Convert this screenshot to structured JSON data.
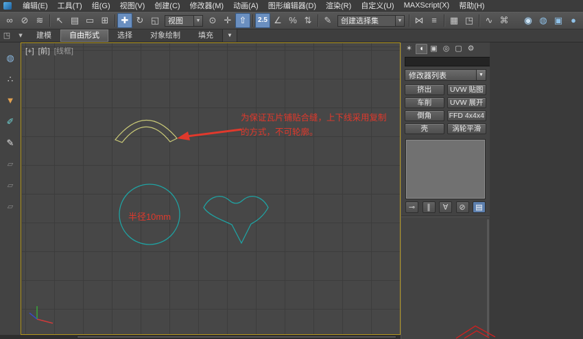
{
  "menu_bar": {
    "items": [
      "编辑(E)",
      "工具(T)",
      "组(G)",
      "视图(V)",
      "创建(C)",
      "修改器(M)",
      "动画(A)",
      "图形编辑器(D)",
      "渲染(R)",
      "自定义(U)",
      "MAXScript(X)",
      "帮助(H)"
    ]
  },
  "ui": {
    "dropdown_arrow": "▼"
  },
  "main_toolbar": {
    "icons": {
      "link": "∞",
      "unlink": "⊘",
      "bind": "≋",
      "select": "↖",
      "select_by_name": "▤",
      "region": "▭",
      "crossing": "⊞",
      "move": "✚",
      "rotate": "↻",
      "scale": "◱",
      "pivot": "⊙",
      "manipulate": "✛",
      "kbd_override": "⇧",
      "snap": "2.5",
      "angle_snap": "∠",
      "percent_snap": "%",
      "spinner_snap": "⇅",
      "named_sets": "✎",
      "mirror": "⋈",
      "align": "≡",
      "layers": "▦",
      "graphite": "◳",
      "curve_editor": "∿",
      "schematic_view": "⌘",
      "material_editor": "◉",
      "render_setup": "◍",
      "rendered_frame": "▣",
      "render": "●"
    },
    "ref_coord_dropdown": "视图",
    "selection_set_dropdown": "创建选择集"
  },
  "ribbon": {
    "tabs": [
      "建模",
      "自由形式",
      "选择",
      "对象绘制",
      "填充"
    ],
    "left_icon": "◳",
    "pin_icon": "▾",
    "dropdown_icon": "▼"
  },
  "left_toolbar": {
    "icons": [
      "◍",
      "∴",
      "▼",
      "✐",
      "✎",
      "▱",
      "▱",
      "▱"
    ]
  },
  "viewport": {
    "label_plus": "[+]",
    "label_view": "[前]",
    "label_shading": "[线框]",
    "annotation_line1": "为保证瓦片铺贴合缝，上下线采用复制",
    "annotation_line2": "的方式，不可轮廓。",
    "circle_label": "半径10mm",
    "colors": {
      "annotation_red": "#e0392c",
      "spline_yellow": "#cbcb78",
      "spline_cyan": "#1fa3a3",
      "active_border": "#b5981e",
      "background": "#474747",
      "grid_line": "#3c3c3c"
    }
  },
  "command_panel": {
    "tab_icons": {
      "create": "✶",
      "modify": "◖",
      "hierarchy": "▣",
      "motion": "◎",
      "display": "▢",
      "utilities": "⚙"
    },
    "name_value": "",
    "color_swatch": "#a31414",
    "modifier_list_label": "修改器列表",
    "modifier_buttons": [
      "挤出",
      "UVW 贴图",
      "车削",
      "UVW 展开",
      "倒角",
      "FFD 4x4x4",
      "壳",
      "涡轮平滑"
    ],
    "stack_icons": {
      "pin_stack": "⊸",
      "show_end_result": "∥",
      "make_unique": "∀",
      "remove_modifier": "⊘",
      "configure_sets": "▤"
    }
  }
}
